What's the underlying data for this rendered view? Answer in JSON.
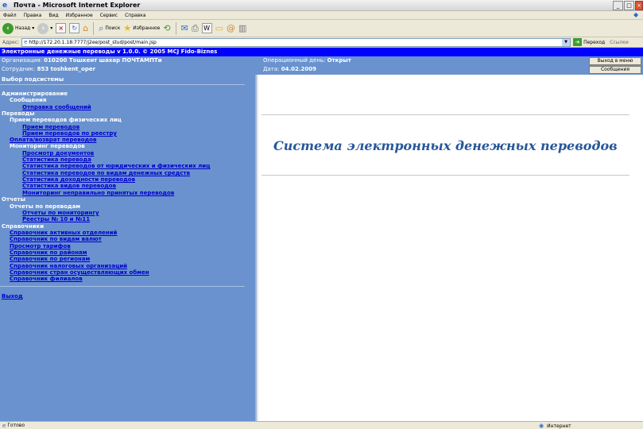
{
  "window": {
    "title": "Почта - Microsoft Internet Explorer",
    "minimize_glyph": "_",
    "maximize_glyph": "□",
    "close_glyph": "×"
  },
  "menu": [
    "Файл",
    "Правка",
    "Вид",
    "Избранное",
    "Сервис",
    "Справка"
  ],
  "toolbar": {
    "back_label": "Назад",
    "search_label": "Поиск",
    "favorites_label": "Избранное"
  },
  "address": {
    "label": "Адрес:",
    "url": "http://172.20.1.18:7777/j2ee/post_stud/post/main.jsp",
    "go_label": "Переход",
    "links_label": "Ссылки"
  },
  "app": {
    "header": "Электронные денежные переводы v 1.0.0. © 2005 MCJ Fido-Biznes",
    "org_label": "Организация: ",
    "org_value": "010200 Тошкент шахар ПОЧТАМПТи",
    "employee_label": "Сотрудник: ",
    "employee_value": "853 toshkent_oper",
    "opday_label": "Операционный день: ",
    "opday_value": "Открыт",
    "date_label": "Дата: ",
    "date_value": "04.02.2009",
    "exit_menu_button": "Выход в меню",
    "messages_button": "Сообщения"
  },
  "sidebar": {
    "title": "Выбор подсистемы",
    "items": [
      {
        "text": "Администрирование",
        "kind": "head"
      },
      {
        "text": "Сообщения",
        "kind": "head"
      },
      {
        "text": "Отправка сообщений",
        "kind": "link"
      },
      {
        "text": "Переводы",
        "kind": "head"
      },
      {
        "text": "Прием переводов физических лиц",
        "kind": "head"
      },
      {
        "text": "Прием переводов",
        "kind": "link"
      },
      {
        "text": "Прием переводов по реестру",
        "kind": "link"
      },
      {
        "text": "Оплата/возврат переводов",
        "kind": "link"
      },
      {
        "text": "Мониторинг переводов",
        "kind": "head"
      },
      {
        "text": "Просмотр документов",
        "kind": "link"
      },
      {
        "text": "Статистика перевода",
        "kind": "link"
      },
      {
        "text": "Статистика переводов от юридических и физических лиц",
        "kind": "link"
      },
      {
        "text": "Статистика переводов по видам денежных средств",
        "kind": "link"
      },
      {
        "text": "Статистика доходности переводов",
        "kind": "link"
      },
      {
        "text": "Статистика видов переводов",
        "kind": "link"
      },
      {
        "text": "Мониторинг неправильно принятых переводов",
        "kind": "link"
      },
      {
        "text": "Отчеты",
        "kind": "head"
      },
      {
        "text": "Отчеты по переводам",
        "kind": "head"
      },
      {
        "text": "Отчеты по мониторингу",
        "kind": "link"
      },
      {
        "text": "Реестры № 10 и №11",
        "kind": "link"
      },
      {
        "text": "Справочники",
        "kind": "head"
      },
      {
        "text": "Справочник активных отделений",
        "kind": "link"
      },
      {
        "text": "Справочник по видам валют",
        "kind": "link"
      },
      {
        "text": "Просмотр тарифов",
        "kind": "link"
      },
      {
        "text": "Справочник по районам",
        "kind": "link"
      },
      {
        "text": "Справочник по регионам",
        "kind": "link"
      },
      {
        "text": "Справочник налоговых организаций",
        "kind": "link"
      },
      {
        "text": "Справочник стран осуществляющих обмен",
        "kind": "link"
      },
      {
        "text": "Справочник филиалов",
        "kind": "link"
      }
    ],
    "exit": "Выход"
  },
  "main": {
    "title": "Система электронных денежных переводов"
  },
  "status": {
    "left": "Готово",
    "zone": "Интернет"
  },
  "colors": {
    "header_blue": "#0000ff",
    "panel_blue": "#6992cf",
    "link_blue": "#0000cc",
    "title_blue": "#27579a"
  }
}
